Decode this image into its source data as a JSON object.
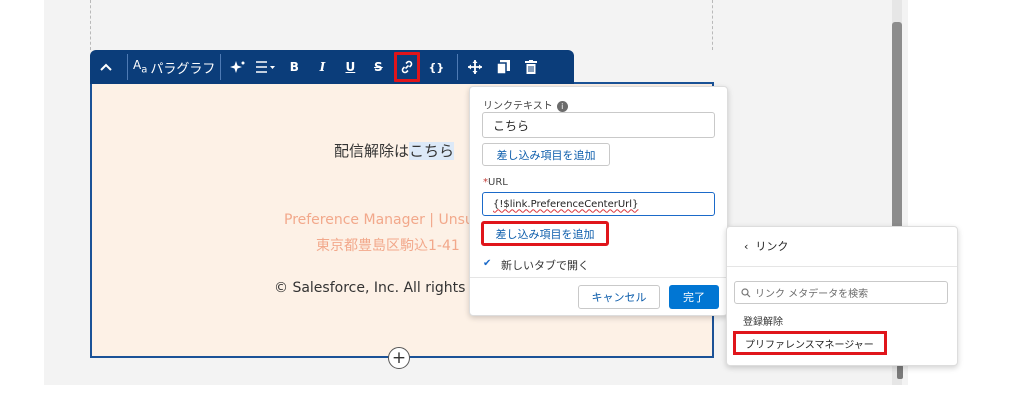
{
  "toolbar": {
    "paragraph_label": "パラグラフ",
    "bold": "B",
    "italic": "I",
    "underline": "U",
    "strike": "S",
    "braces": "{}"
  },
  "email": {
    "unsubscribe_prefix": "配信解除は",
    "unsubscribe_link": "こちら",
    "pref_text": "Preference Manager | Unsu",
    "address_text": "東京都豊島区駒込1-41",
    "copyright": "© Salesforce, Inc. All rights r"
  },
  "link_popover": {
    "link_text_label": "リンクテキスト",
    "link_text_value": "こちら",
    "add_merge_field_1": "差し込み項目を追加",
    "url_required_mark": "*",
    "url_label": "URL",
    "url_value": "{!$link.PreferenceCenterUrl}",
    "add_merge_field_2": "差し込み項目を追加",
    "new_tab_label": "新しいタブで開く",
    "new_tab_checked": true,
    "cancel_label": "キャンセル",
    "done_label": "完了"
  },
  "merge_panel": {
    "back_label": "リンク",
    "search_placeholder": "リンク メタデータを検索",
    "group_label": "登録解除",
    "item_label": "プリファレンスマネージャー"
  },
  "colors": {
    "toolbar_bg": "#0b3d7a",
    "highlight_red": "#e0151b",
    "primary_blue": "#0176d3"
  }
}
